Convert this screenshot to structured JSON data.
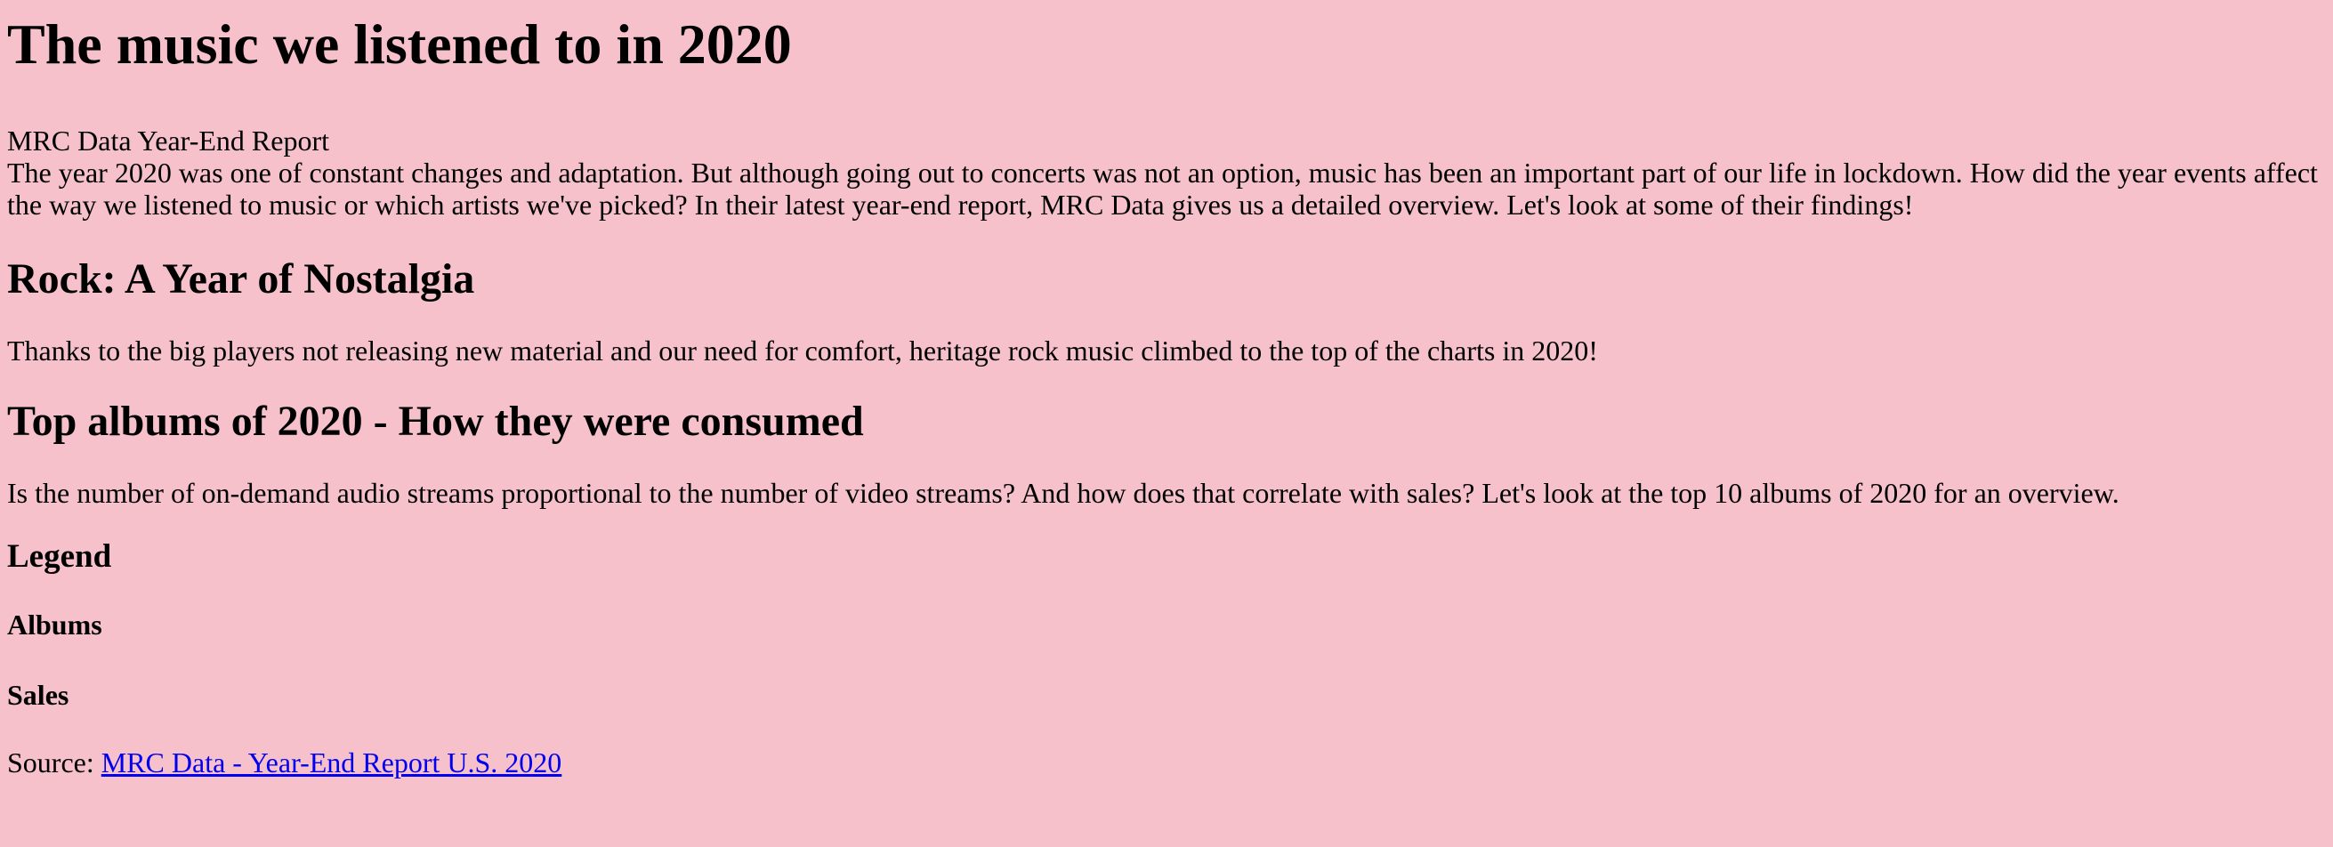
{
  "page": {
    "title": "The music we listened to in 2020",
    "subtitle": "MRC Data Year-End Report",
    "intro": "The year 2020 was one of constant changes and adaptation. But although going out to concerts was not an option, music has been an important part of our life in lockdown. How did the year events affect the way we listened to music or which artists we've picked? In their latest year-end report, MRC Data gives us a detailed overview. Let's look at some of their findings!"
  },
  "rock": {
    "heading": "Rock: A Year of Nostalgia",
    "text": "Thanks to the big players not releasing new material and our need for comfort, heritage rock music climbed to the top of the charts in 2020!"
  },
  "albums": {
    "heading": "Top albums of 2020 - How they were consumed",
    "text": "Is the number of on-demand audio streams proportional to the number of video streams? And how does that correlate with sales? Let's look at the top 10 albums of 2020 for an overview."
  },
  "legend": {
    "heading": "Legend",
    "albums_label": "Albums",
    "sales_label": "Sales"
  },
  "source": {
    "prefix": "Source: ",
    "link_text": "MRC Data - Year-End Report U.S. 2020"
  },
  "colors": {
    "background": "#f6c1cb",
    "link": "#0000ee"
  }
}
